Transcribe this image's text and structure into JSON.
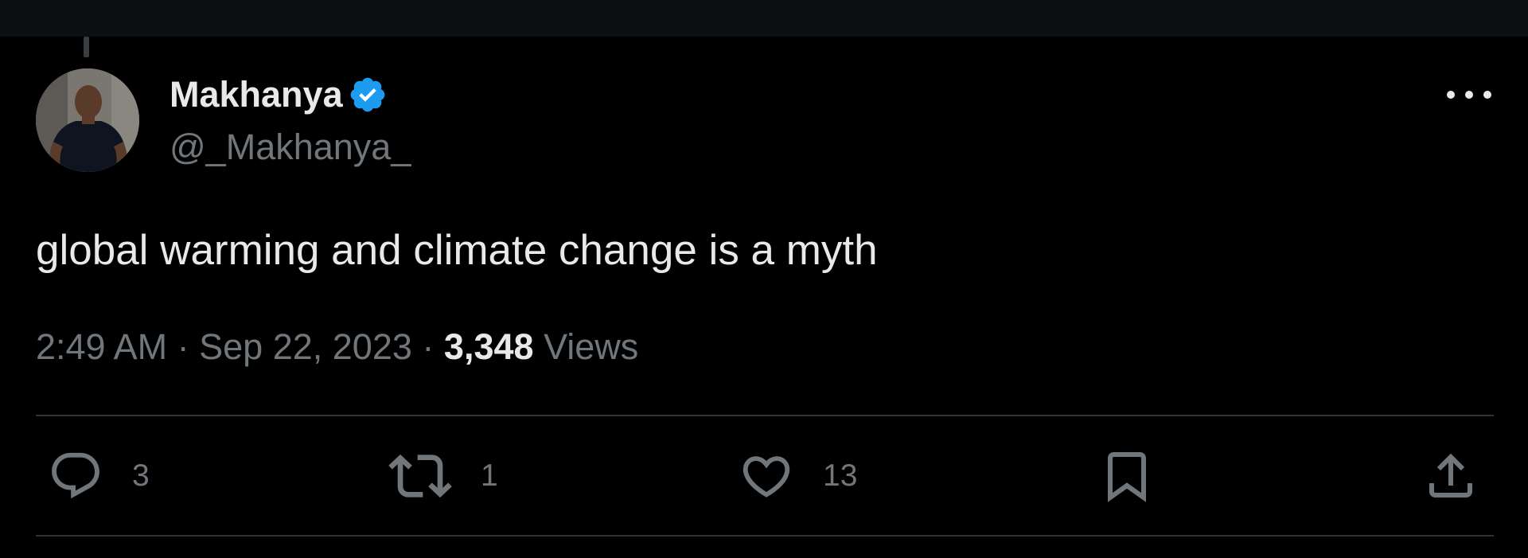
{
  "author": {
    "display_name": "Makhanya",
    "handle": "@_Makhanya_",
    "verified": true
  },
  "tweet": {
    "text": "global warming and climate change is a myth",
    "time": "2:49 AM",
    "separator": "·",
    "date": "Sep 22, 2023",
    "views_count": "3,348",
    "views_label": "Views"
  },
  "actions": {
    "replies": "3",
    "retweets": "1",
    "likes": "13"
  },
  "colors": {
    "background": "#000000",
    "primary_text": "#e7e9ea",
    "secondary_text": "#71767b",
    "verified_blue": "#1d9bf0",
    "divider": "#2f3336"
  },
  "icons": {
    "more": "more-horizontal-icon",
    "reply": "reply-icon",
    "retweet": "retweet-icon",
    "like": "heart-icon",
    "bookmark": "bookmark-icon",
    "share": "share-icon",
    "verified": "verified-badge-icon"
  }
}
